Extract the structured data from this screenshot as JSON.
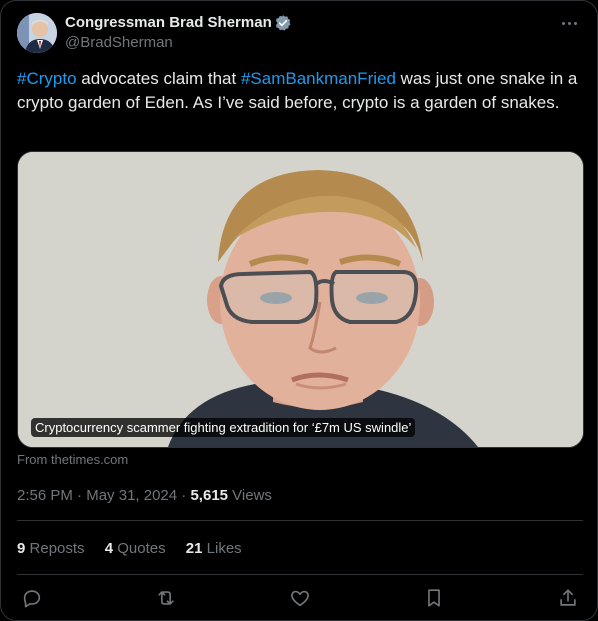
{
  "author": {
    "name": "Congressman Brad Sherman",
    "handle": "@BradSherman"
  },
  "tweet": {
    "text_parts": [
      {
        "type": "hashtag",
        "text": "#Crypto"
      },
      {
        "type": "text",
        "text": " advocates claim that "
      },
      {
        "type": "hashtag",
        "text": "#SamBankmanFried"
      },
      {
        "type": "text",
        "text": " was just one snake in a crypto garden of Eden. As I’ve said before, crypto is a garden of snakes."
      }
    ]
  },
  "media": {
    "caption": "Cryptocurrency scammer fighting extradition for ‘£7m US swindle’",
    "source": "From thetimes.com"
  },
  "meta": {
    "time": "2:56 PM",
    "sep1": " · ",
    "date": "May 31, 2024",
    "sep2": " · ",
    "views_count": "5,615",
    "views_label": " Views"
  },
  "stats": {
    "reposts_count": "9",
    "reposts_label": "Reposts",
    "quotes_count": "4",
    "quotes_label": "Quotes",
    "likes_count": "21",
    "likes_label": "Likes"
  },
  "icons": [
    "verified-badge-icon",
    "more-icon",
    "reply-icon",
    "repost-icon",
    "like-icon",
    "bookmark-icon",
    "share-icon"
  ],
  "colors": {
    "accent": "#1d9bf0",
    "muted": "#71767b",
    "text": "#e7e9ea",
    "background": "#000000"
  }
}
